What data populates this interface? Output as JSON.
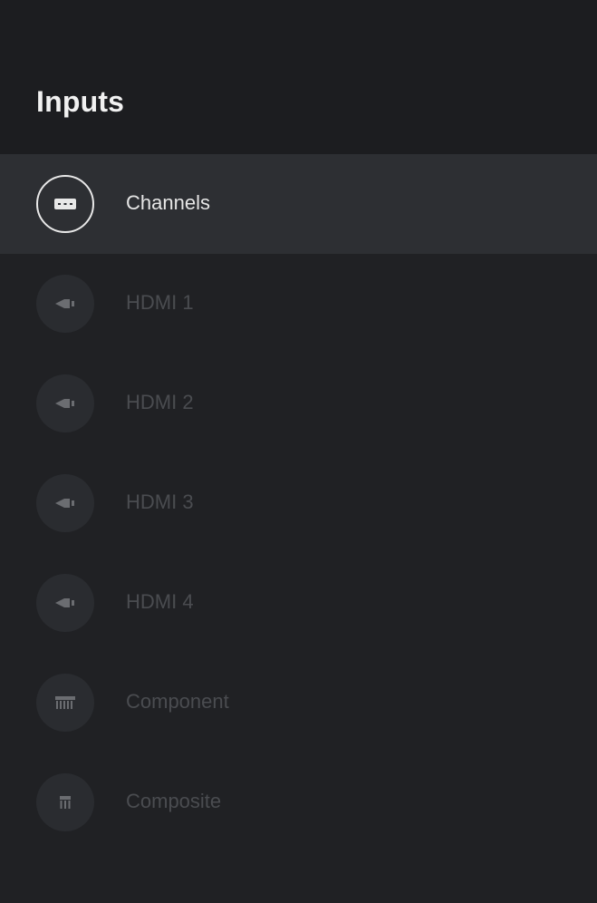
{
  "header": {
    "title": "Inputs"
  },
  "inputs": [
    {
      "label": "Channels",
      "icon": "tv-channels-icon",
      "selected": true
    },
    {
      "label": "HDMI 1",
      "icon": "hdmi-icon",
      "selected": false
    },
    {
      "label": "HDMI 2",
      "icon": "hdmi-icon",
      "selected": false
    },
    {
      "label": "HDMI 3",
      "icon": "hdmi-icon",
      "selected": false
    },
    {
      "label": "HDMI 4",
      "icon": "hdmi-icon",
      "selected": false
    },
    {
      "label": "Component",
      "icon": "component-icon",
      "selected": false
    },
    {
      "label": "Composite",
      "icon": "composite-icon",
      "selected": false
    }
  ],
  "colors": {
    "background": "#202124",
    "header_background": "#1c1d20",
    "selected_row": "#2d2f33",
    "selected_text": "#e6e6e6",
    "dimmed_text": "#4a4c50"
  }
}
